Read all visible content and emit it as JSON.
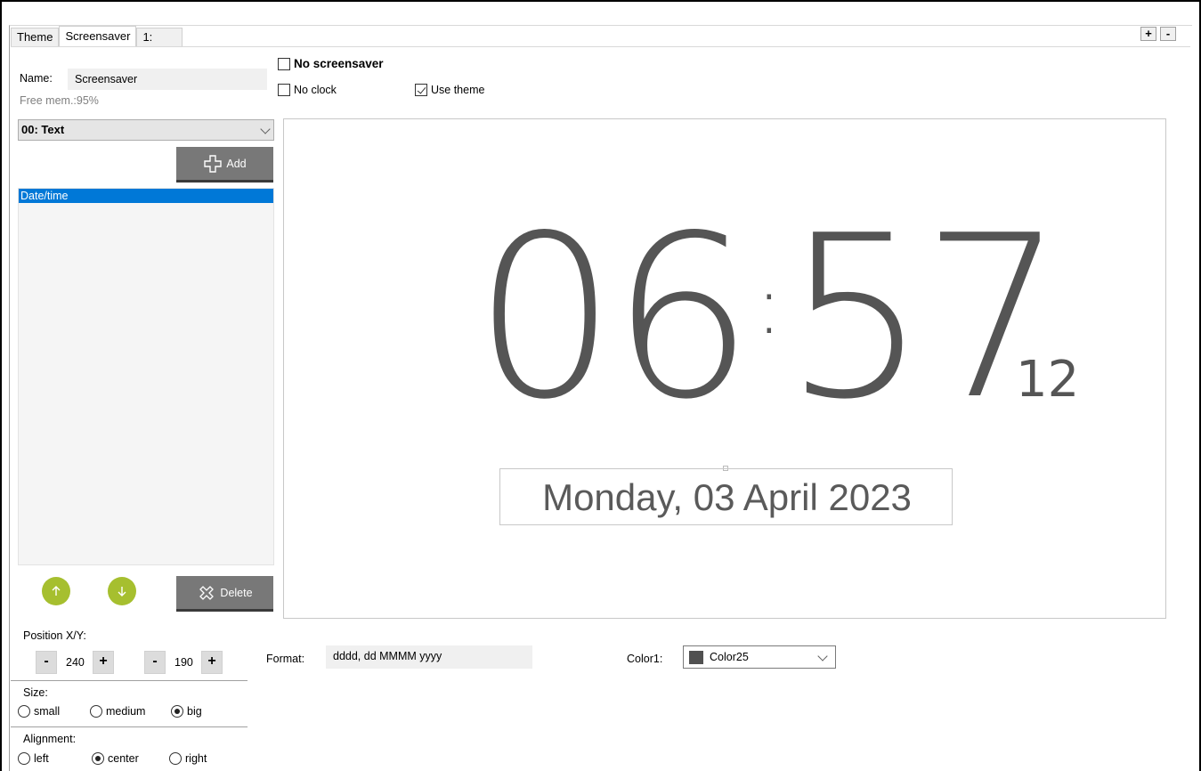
{
  "tabs": [
    {
      "label": "Theme"
    },
    {
      "label": "Screensaver"
    },
    {
      "label": "1:"
    }
  ],
  "tab_controls": {
    "add": "+",
    "remove": "-"
  },
  "left": {
    "name_label": "Name:",
    "name_value": "Screensaver",
    "free_mem": "Free mem.:95%",
    "element_select": "00: Text",
    "add_label": "Add",
    "list_items": [
      "Date/time"
    ],
    "delete_label": "Delete"
  },
  "options": {
    "no_screensaver": {
      "label": "No screensaver",
      "checked": false
    },
    "no_clock": {
      "label": "No clock",
      "checked": false
    },
    "use_theme": {
      "label": "Use theme",
      "checked": true
    }
  },
  "preview": {
    "hours": "06",
    "separator": ":",
    "minutes": "57",
    "seconds": "12",
    "date": "Monday, 03 April 2023",
    "text_color": "#555555"
  },
  "position": {
    "label": "Position X/Y:",
    "x": "240",
    "y": "190",
    "minus": "-",
    "plus": "+"
  },
  "size": {
    "label": "Size:",
    "options": [
      "small",
      "medium",
      "big"
    ],
    "selected": "big"
  },
  "alignment": {
    "label": "Alignment:",
    "options": [
      "left",
      "center",
      "right"
    ],
    "selected": "center"
  },
  "format": {
    "label": "Format:",
    "value": "dddd, dd MMMM yyyy"
  },
  "color1": {
    "label": "Color1:",
    "value": "Color25",
    "swatch": "#505050"
  },
  "colors": {
    "accent_green": "#a6bf2f",
    "selection_blue": "#0078d7",
    "button_gray": "#787878"
  },
  "icons": {
    "add": "plus-outline-icon",
    "delete": "x-outline-icon",
    "up": "arrow-up-icon",
    "down": "arrow-down-icon"
  }
}
